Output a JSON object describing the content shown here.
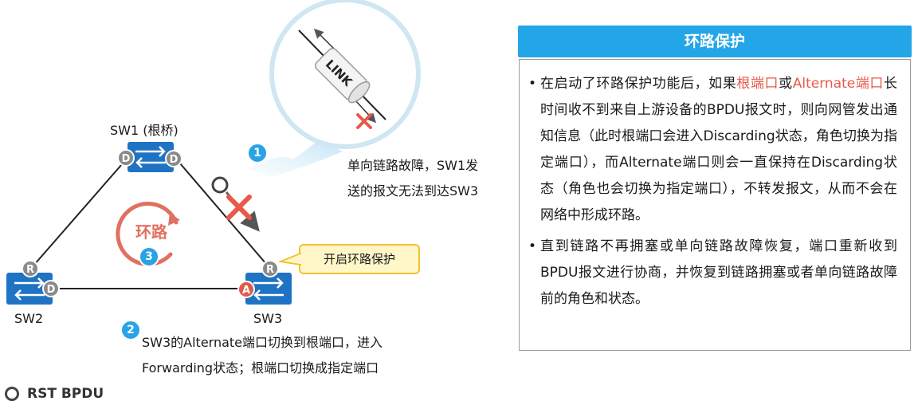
{
  "colors": {
    "switch_blue": "#1f73c4",
    "port_gray": "#8a8a8a",
    "alternate_red": "#e05a4c",
    "badge_blue": "#2aa3e6",
    "panel_blue": "#22a6e8",
    "highlight_red": "#e8594a"
  },
  "diagram": {
    "sw1_label": "SW1 (根桥)",
    "sw2_label": "SW2",
    "sw3_label": "SW3",
    "port_sw1_left": "D",
    "port_sw1_right": "D",
    "port_sw2_top": "R",
    "port_sw2_right": "D",
    "port_sw3_top": "R",
    "port_sw3_left": "A",
    "loop_label": "环路",
    "link_label": "LINK",
    "step1_badge": "1",
    "step2_badge": "2",
    "step3_badge": "3",
    "step1_text_line1": "单向链路故障，SW1发",
    "step1_text_line2": "送的报文无法到达SW3",
    "step2_text_line1": "SW3的Alternate端口切换到根端口，进入",
    "step2_text_line2": "Forwarding状态；根端口切换成指定端口",
    "tip_text": "开启环路保护"
  },
  "panel": {
    "title": "环路保护",
    "bullet1_pre": "在启动了环路保护功能后，如果",
    "bullet1_red1": "根端口",
    "bullet1_mid": "或",
    "bullet1_red2": "Alternate端口",
    "bullet1_post": "长时间收不到来自上游设备的BPDU报文时，则向网管发出通知信息（此时根端口会进入Discarding状态，角色切换为指定端口），而Alternate端口则会一直保持在Discarding状态（角色也会切换为指定端口），不转发报文，从而不会在网络中形成环路。",
    "bullet2": "直到链路不再拥塞或单向链路故障恢复，端口重新收到BPDU报文进行协商，并恢复到链路拥塞或者单向链路故障前的角色和状态。"
  },
  "legend": {
    "label": "RST BPDU"
  }
}
